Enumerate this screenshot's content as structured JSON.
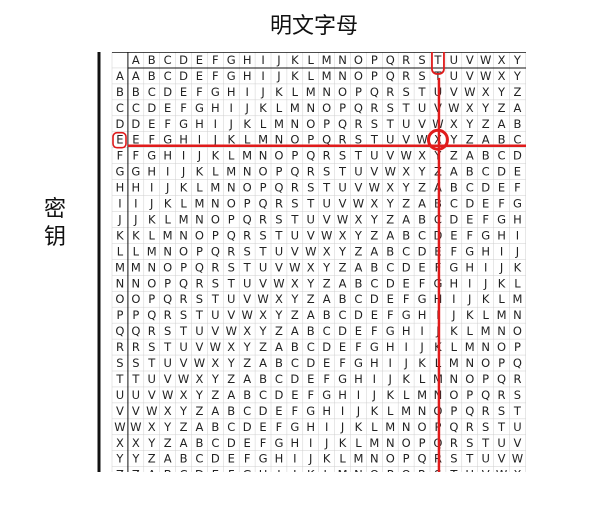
{
  "title": "明文字母",
  "side_label": [
    "密",
    "钥"
  ],
  "header_row": [
    "A",
    "B",
    "C",
    "D",
    "E",
    "F",
    "G",
    "H",
    "I",
    "J",
    "K",
    "L",
    "M",
    "N",
    "O",
    "P",
    "Q",
    "R",
    "S",
    "T",
    "U",
    "V",
    "W",
    "X",
    "Y",
    "Z"
  ],
  "key_column": [
    "A",
    "B",
    "C",
    "D",
    "E",
    "F",
    "G",
    "H",
    "I",
    "J",
    "K",
    "L",
    "M",
    "N",
    "O",
    "P",
    "Q",
    "R",
    "S",
    "T",
    "U",
    "V",
    "W",
    "X",
    "Y",
    "Z"
  ],
  "table_rows": [
    "ABCDEFGHIJKLMNOPQRSTUVWXYZ",
    "BCDEFGHIJKLMNOPQRSTUVWXYZA",
    "CDEFGHIJKLMNOPQRSTUVWXYZAB",
    "DEFGHIJKLMNOPQRSTUVWXYZABC",
    "EFGHIJKLMNOPQRSTUVWXYZABCD",
    "FGHIJKLMNOPQRSTUVWXYZABCDE",
    "GHIJKLMNOPQRSTUVWXYZABCDEF",
    "HIJKLMNOPQRSTUVWXYZABCDEFG",
    "IJKLMNOPQRSTUVWXYZABCDEFGH",
    "JKLMNOPQRSTUVWXYZABCDEFGHI",
    "KLMNOPQRSTUVWXYZABCDEFGHIJ",
    "LMNOPQRSTUVWXYZABCDEFGHIJK",
    "MNOPQRSTUVWXYZABCDEFGHIJKL",
    "NOPQRSTUVWXYZABCDEFGHIJKLM",
    "OPQRSTUVWXYZABCDEFGHIJKLMN",
    "PQRSTUVWXYZABCDEFGHIJKLMNO",
    "QRSTUVWXYZABCDEFGHIJKLMNOP",
    "RSTUVWXYZABCDEFGHIJKLMNOPQ",
    "STUVWXYZABCDEFGHIJKLMNOPQR",
    "TUVWXYZABCDEFGHIJKLMNOPQRS",
    "UVWXYZABCDEFGHIJKLMNOPQRST",
    "VWXYZABCDEFGHIJKLMNOPQRSTU",
    "WXYZABCDEFGHIJKLMNOPQRSTUV",
    "XYZABCDEFGHIJKLMNOPQRSTUVW",
    "YZABCDEFGHIJKLMNOPQRSTUVWX",
    "ZABCDEFGHIJKLMNOPQRSTUVWXY"
  ],
  "highlight": {
    "plaintext_letter": "T",
    "key_letter": "E",
    "cipher_letter": "X",
    "plaintext_col_index": 19,
    "key_row_index": 4
  },
  "colors": {
    "highlight": "#e01b1b",
    "grid": "#cfcfcf",
    "text": "#222222",
    "frame": "#111111"
  }
}
